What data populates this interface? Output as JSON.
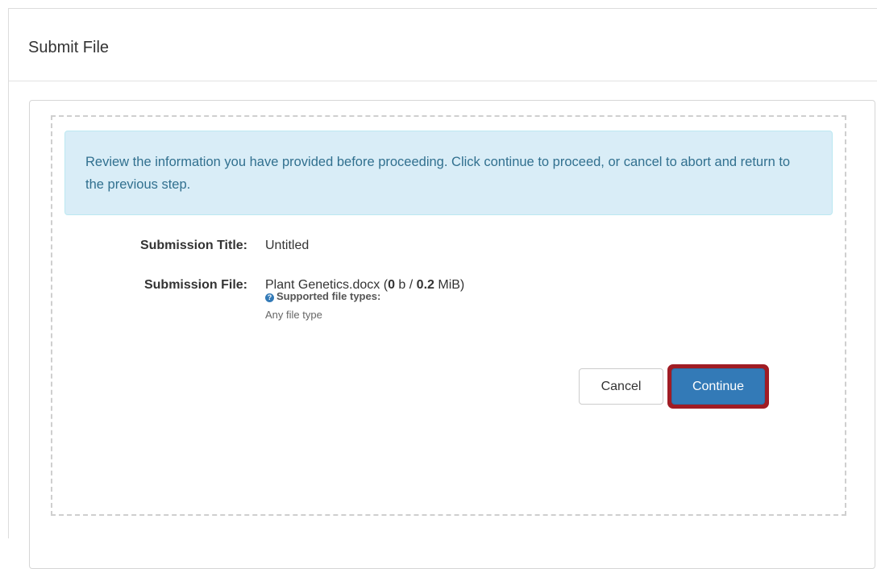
{
  "header": {
    "title": "Submit File"
  },
  "alert": {
    "message": "Review the information you have provided before proceeding. Click continue to proceed, or cancel to abort and return to the previous step."
  },
  "fields": {
    "title_label": "Submission Title:",
    "title_value": "Untitled",
    "file_label": "Submission File:",
    "file_name": "Plant Genetics.docx",
    "file_open": " (",
    "file_size_uploaded": "0",
    "file_size_sep": " b / ",
    "file_size_total": "0.2",
    "file_size_unit": " MiB)"
  },
  "help": {
    "icon_glyph": "?",
    "label": "Supported file types:",
    "value": "Any file type"
  },
  "buttons": {
    "cancel": "Cancel",
    "continue": "Continue"
  },
  "colors": {
    "primary": "#337ab7",
    "highlight_ring": "#a01c24",
    "alert_bg": "#d9edf7",
    "alert_text": "#31708f"
  }
}
